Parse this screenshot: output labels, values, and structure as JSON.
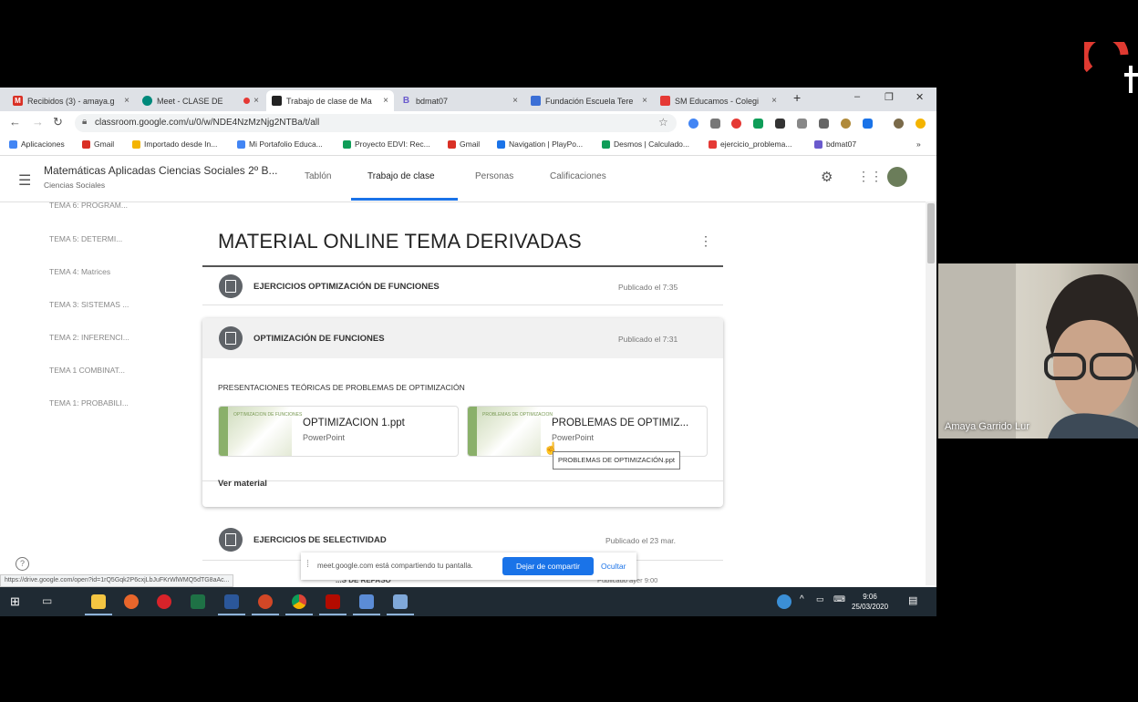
{
  "browser": {
    "tabs": [
      {
        "label": "Recibidos (3) - amaya.g",
        "icon": "gmail-icon",
        "color": "#d93025",
        "letter": "M"
      },
      {
        "label": "Meet - CLASE DE",
        "icon": "meet-icon",
        "color": "#00897b",
        "letter": ""
      },
      {
        "label": "Trabajo de clase de Ma",
        "icon": "classroom-icon",
        "color": "#222222",
        "letter": ""
      },
      {
        "label": "bdmat07",
        "icon": "b-icon",
        "color": "#6a5acd",
        "letter": "B"
      },
      {
        "label": "Fundación Escuela Tere",
        "icon": "grid-icon",
        "color": "#3b6fd6",
        "letter": ""
      },
      {
        "label": "SM Educamos - Colegi",
        "icon": "sm-icon",
        "color": "#e53935",
        "letter": ""
      }
    ],
    "new_tab": "+",
    "url": "classroom.google.com/u/0/w/NDE4NzMzNjg2NTBa/t/all"
  },
  "bookmarks": [
    {
      "label": "Aplicaciones",
      "color": "#4285f4"
    },
    {
      "label": "Gmail",
      "color": "#d93025"
    },
    {
      "label": "Importado desde In...",
      "color": "#f4b400"
    },
    {
      "label": "Mi Portafolio Educa...",
      "color": "#4285f4"
    },
    {
      "label": "Proyecto EDVI: Rec...",
      "color": "#0f9d58"
    },
    {
      "label": "Gmail",
      "color": "#d93025"
    },
    {
      "label": "Navigation | PlayPo...",
      "color": "#1a73e8"
    },
    {
      "label": "Desmos | Calculado...",
      "color": "#0f9d58"
    },
    {
      "label": "ejercicio_problema...",
      "color": "#e53935"
    },
    {
      "label": "bdmat07",
      "color": "#6a5acd"
    }
  ],
  "classroom": {
    "title": "Matemáticas Aplicadas Ciencias Sociales 2º B...",
    "subtitle": "Ciencias Sociales",
    "tabs": [
      "Tablón",
      "Trabajo de clase",
      "Personas",
      "Calificaciones"
    ],
    "active_tab": "Trabajo de clase"
  },
  "topics": [
    "TEMA 6: PROGRAM...",
    "TEMA 5: DETERMI...",
    "TEMA 4: Matrices",
    "TEMA 3: SISTEMAS ...",
    "TEMA 2: INFERENCI...",
    "TEMA 1 COMBINAT...",
    "TEMA 1: PROBABILI..."
  ],
  "section_title": "MATERIAL ONLINE TEMA DERIVADAS",
  "items": [
    {
      "title": "EJERCICIOS OPTIMIZACIÓN DE FUNCIONES",
      "meta": "Publicado el 7:35"
    },
    {
      "title": "OPTIMIZACIÓN DE FUNCIONES",
      "meta": "Publicado el 7:31"
    },
    {
      "title": "EJERCICIOS DE SELECTIVIDAD",
      "meta": "Publicado el 23 mar."
    }
  ],
  "card": {
    "description": "PRESENTACIONES TEÓRICAS DE PROBLEMAS DE OPTIMIZACIÓN",
    "attachments": [
      {
        "title": "OPTIMIZACION 1.ppt",
        "type": "PowerPoint",
        "thumb": "OPTIMIZACION DE FUNCIONES"
      },
      {
        "title": "PROBLEMAS DE OPTIMIZ...",
        "type": "PowerPoint",
        "thumb": "PROBLEMAS DE OPTIMIZACION"
      }
    ],
    "view_material": "Ver material",
    "tooltip": "PROBLEMAS DE OPTIMIZACIÓN.ppt"
  },
  "partial_row": {
    "title": "...S DE REPASO",
    "meta": "Publicado ayer 9:00"
  },
  "share_bar": {
    "message": "meet.google.com está compartiendo tu pantalla.",
    "stop": "Dejar de compartir",
    "hide": "Ocultar"
  },
  "status_url": "https://drive.google.com/open?id=1rQ5Gqk2P6cxjLbJuFKrWlWMQ5dTG8aAc...",
  "clock": {
    "time": "9:06",
    "date": "25/03/2020"
  },
  "webcam": {
    "name": "Amaya Garrido Lur"
  }
}
